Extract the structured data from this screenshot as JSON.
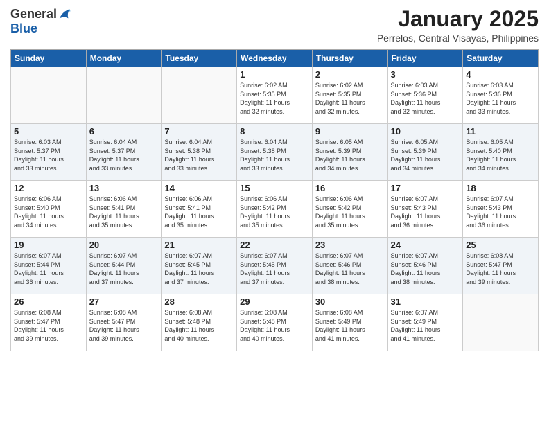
{
  "header": {
    "logo_line1": "General",
    "logo_line2": "Blue",
    "month_title": "January 2025",
    "location": "Perrelos, Central Visayas, Philippines"
  },
  "weekdays": [
    "Sunday",
    "Monday",
    "Tuesday",
    "Wednesday",
    "Thursday",
    "Friday",
    "Saturday"
  ],
  "weeks": [
    [
      {
        "day": "",
        "info": ""
      },
      {
        "day": "",
        "info": ""
      },
      {
        "day": "",
        "info": ""
      },
      {
        "day": "1",
        "info": "Sunrise: 6:02 AM\nSunset: 5:35 PM\nDaylight: 11 hours\nand 32 minutes."
      },
      {
        "day": "2",
        "info": "Sunrise: 6:02 AM\nSunset: 5:35 PM\nDaylight: 11 hours\nand 32 minutes."
      },
      {
        "day": "3",
        "info": "Sunrise: 6:03 AM\nSunset: 5:36 PM\nDaylight: 11 hours\nand 32 minutes."
      },
      {
        "day": "4",
        "info": "Sunrise: 6:03 AM\nSunset: 5:36 PM\nDaylight: 11 hours\nand 33 minutes."
      }
    ],
    [
      {
        "day": "5",
        "info": "Sunrise: 6:03 AM\nSunset: 5:37 PM\nDaylight: 11 hours\nand 33 minutes."
      },
      {
        "day": "6",
        "info": "Sunrise: 6:04 AM\nSunset: 5:37 PM\nDaylight: 11 hours\nand 33 minutes."
      },
      {
        "day": "7",
        "info": "Sunrise: 6:04 AM\nSunset: 5:38 PM\nDaylight: 11 hours\nand 33 minutes."
      },
      {
        "day": "8",
        "info": "Sunrise: 6:04 AM\nSunset: 5:38 PM\nDaylight: 11 hours\nand 33 minutes."
      },
      {
        "day": "9",
        "info": "Sunrise: 6:05 AM\nSunset: 5:39 PM\nDaylight: 11 hours\nand 34 minutes."
      },
      {
        "day": "10",
        "info": "Sunrise: 6:05 AM\nSunset: 5:39 PM\nDaylight: 11 hours\nand 34 minutes."
      },
      {
        "day": "11",
        "info": "Sunrise: 6:05 AM\nSunset: 5:40 PM\nDaylight: 11 hours\nand 34 minutes."
      }
    ],
    [
      {
        "day": "12",
        "info": "Sunrise: 6:06 AM\nSunset: 5:40 PM\nDaylight: 11 hours\nand 34 minutes."
      },
      {
        "day": "13",
        "info": "Sunrise: 6:06 AM\nSunset: 5:41 PM\nDaylight: 11 hours\nand 35 minutes."
      },
      {
        "day": "14",
        "info": "Sunrise: 6:06 AM\nSunset: 5:41 PM\nDaylight: 11 hours\nand 35 minutes."
      },
      {
        "day": "15",
        "info": "Sunrise: 6:06 AM\nSunset: 5:42 PM\nDaylight: 11 hours\nand 35 minutes."
      },
      {
        "day": "16",
        "info": "Sunrise: 6:06 AM\nSunset: 5:42 PM\nDaylight: 11 hours\nand 35 minutes."
      },
      {
        "day": "17",
        "info": "Sunrise: 6:07 AM\nSunset: 5:43 PM\nDaylight: 11 hours\nand 36 minutes."
      },
      {
        "day": "18",
        "info": "Sunrise: 6:07 AM\nSunset: 5:43 PM\nDaylight: 11 hours\nand 36 minutes."
      }
    ],
    [
      {
        "day": "19",
        "info": "Sunrise: 6:07 AM\nSunset: 5:44 PM\nDaylight: 11 hours\nand 36 minutes."
      },
      {
        "day": "20",
        "info": "Sunrise: 6:07 AM\nSunset: 5:44 PM\nDaylight: 11 hours\nand 37 minutes."
      },
      {
        "day": "21",
        "info": "Sunrise: 6:07 AM\nSunset: 5:45 PM\nDaylight: 11 hours\nand 37 minutes."
      },
      {
        "day": "22",
        "info": "Sunrise: 6:07 AM\nSunset: 5:45 PM\nDaylight: 11 hours\nand 37 minutes."
      },
      {
        "day": "23",
        "info": "Sunrise: 6:07 AM\nSunset: 5:46 PM\nDaylight: 11 hours\nand 38 minutes."
      },
      {
        "day": "24",
        "info": "Sunrise: 6:07 AM\nSunset: 5:46 PM\nDaylight: 11 hours\nand 38 minutes."
      },
      {
        "day": "25",
        "info": "Sunrise: 6:08 AM\nSunset: 5:47 PM\nDaylight: 11 hours\nand 39 minutes."
      }
    ],
    [
      {
        "day": "26",
        "info": "Sunrise: 6:08 AM\nSunset: 5:47 PM\nDaylight: 11 hours\nand 39 minutes."
      },
      {
        "day": "27",
        "info": "Sunrise: 6:08 AM\nSunset: 5:47 PM\nDaylight: 11 hours\nand 39 minutes."
      },
      {
        "day": "28",
        "info": "Sunrise: 6:08 AM\nSunset: 5:48 PM\nDaylight: 11 hours\nand 40 minutes."
      },
      {
        "day": "29",
        "info": "Sunrise: 6:08 AM\nSunset: 5:48 PM\nDaylight: 11 hours\nand 40 minutes."
      },
      {
        "day": "30",
        "info": "Sunrise: 6:08 AM\nSunset: 5:49 PM\nDaylight: 11 hours\nand 41 minutes."
      },
      {
        "day": "31",
        "info": "Sunrise: 6:07 AM\nSunset: 5:49 PM\nDaylight: 11 hours\nand 41 minutes."
      },
      {
        "day": "",
        "info": ""
      }
    ]
  ]
}
